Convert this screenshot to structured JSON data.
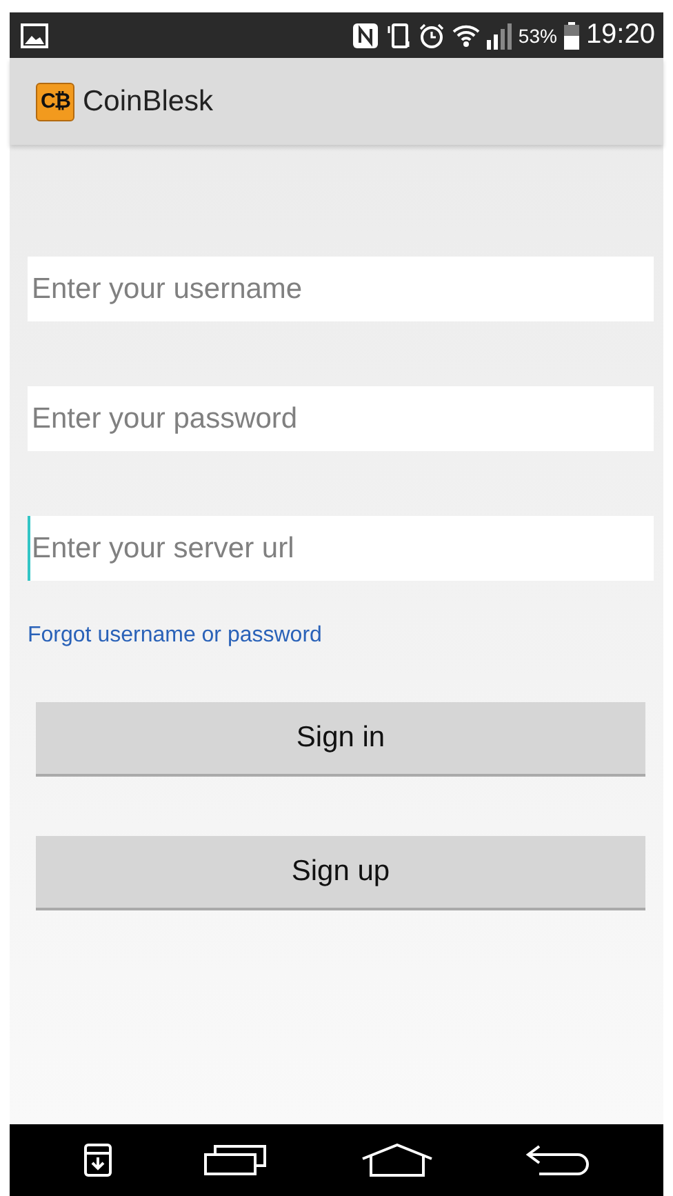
{
  "status_bar": {
    "battery": "53%",
    "time": "19:20"
  },
  "app_bar": {
    "logo_text": "C₿",
    "title": "CoinBlesk"
  },
  "fields": [
    {
      "placeholder": "Enter your username",
      "focused": false
    },
    {
      "placeholder": "Enter your password",
      "focused": false
    },
    {
      "placeholder": "Enter your server url",
      "focused": true
    }
  ],
  "forgot_link": "Forgot username or password",
  "buttons": [
    "Sign in",
    "Sign up"
  ]
}
